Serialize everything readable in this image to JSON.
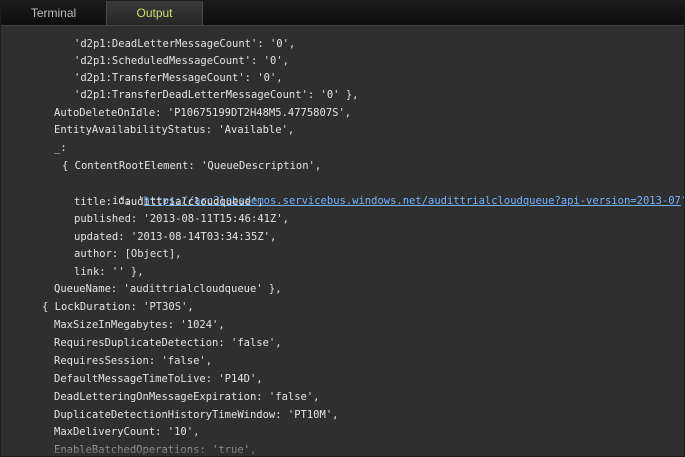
{
  "tabs": [
    {
      "label": "Terminal"
    },
    {
      "label": "Output"
    }
  ],
  "output": {
    "lines": [
      {
        "text": "'d2p1:DeadLetterMessageCount': '0',"
      },
      {
        "text": "'d2p1:ScheduledMessageCount': '0',"
      },
      {
        "text": "'d2p1:TransferMessageCount': '0',"
      },
      {
        "text": "'d2p1:TransferDeadLetterMessageCount': '0' },"
      },
      {
        "text": "AutoDeleteOnIdle: 'P10675199DT2H48M5.4775807S',"
      },
      {
        "text": "EntityAvailabilityStatus: 'Available',"
      },
      {
        "text": "_:"
      },
      {
        "text": "{ ContentRootElement: 'QueueDescription',"
      },
      {
        "text_before": "id: '",
        "link": "https://arc3labsdemos.servicebus.windows.net/audittrialcloudqueue?api-version=2013-07",
        "text_after": "',"
      },
      {
        "text": "title: 'audittrialcloudqueue',"
      },
      {
        "text": "published: '2013-08-11T15:46:41Z',"
      },
      {
        "text": "updated: '2013-08-14T03:34:35Z',"
      },
      {
        "text": "author: [Object],"
      },
      {
        "text": "link: '' },"
      },
      {
        "text": "QueueName: 'audittrialcloudqueue' },"
      },
      {
        "text": "{ LockDuration: 'PT30S',"
      },
      {
        "text": "MaxSizeInMegabytes: '1024',"
      },
      {
        "text": "RequiresDuplicateDetection: 'false',"
      },
      {
        "text": "RequiresSession: 'false',"
      },
      {
        "text": "DefaultMessageTimeToLive: 'P14D',"
      },
      {
        "text": "DeadLetteringOnMessageExpiration: 'false',"
      },
      {
        "text": "DuplicateDetectionHistoryTimeWindow: 'PT10M',"
      },
      {
        "text": "MaxDeliveryCount: '10',"
      },
      {
        "text": "EnableBatchedOperations: 'true',"
      }
    ]
  }
}
